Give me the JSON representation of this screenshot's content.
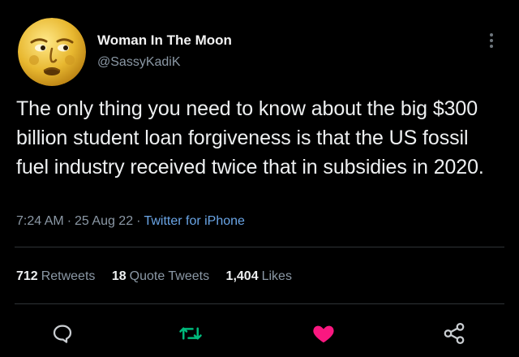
{
  "author": {
    "display_name": "Woman In The Moon",
    "handle": "@SassyKadiK",
    "avatar_icon": "moon-face-emoji-icon"
  },
  "tweet": {
    "text": "The only thing you need to know about the big $300 billion student loan forgiveness is that the US fossil fuel industry received twice that in subsidies in 2020.",
    "time": "7:24 AM",
    "date": "25 Aug 22",
    "separator": "·",
    "source": "Twitter for iPhone"
  },
  "stats": {
    "retweets_count": "712",
    "retweets_label": "Retweets",
    "quote_count": "18",
    "quote_label": "Quote Tweets",
    "likes_count": "1,404",
    "likes_label": "Likes"
  },
  "actions": {
    "reply_icon": "reply-icon",
    "retweet_icon": "retweet-icon",
    "like_icon": "heart-icon",
    "share_icon": "share-icon",
    "more_icon": "more-vertical-icon"
  },
  "colors": {
    "background": "#000000",
    "primary_text": "#e7e9ea",
    "secondary_text": "#8b98a5",
    "link": "#6aa5e6",
    "retweet_green": "#00ba7c",
    "like_pink": "#f91880",
    "divider": "#2f3336"
  }
}
